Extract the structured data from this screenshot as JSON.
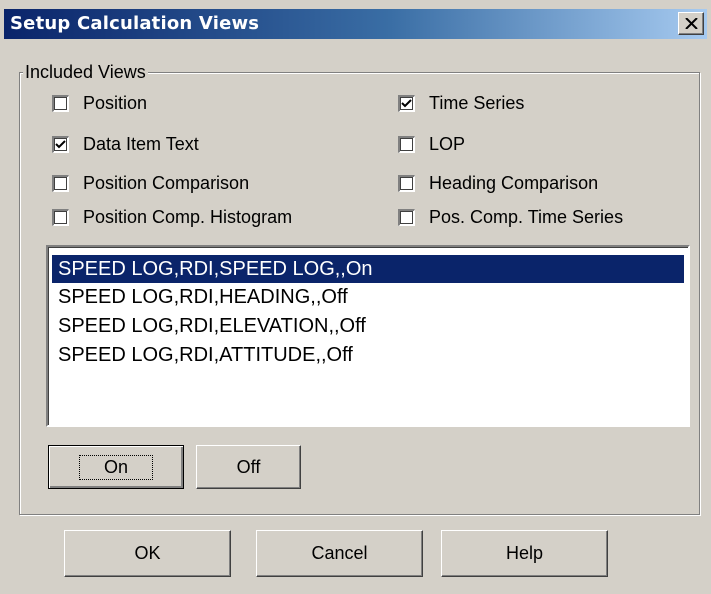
{
  "window": {
    "title": "Setup Calculation Views",
    "close_glyph": "close-icon"
  },
  "included_views": {
    "legend": "Included Views",
    "checkboxes": [
      {
        "label": "Position",
        "checked": false
      },
      {
        "label": "Time Series",
        "checked": true
      },
      {
        "label": "Data Item Text",
        "checked": true
      },
      {
        "label": "LOP",
        "checked": false
      },
      {
        "label": "Position Comparison",
        "checked": false
      },
      {
        "label": "Heading Comparison",
        "checked": false
      },
      {
        "label": "Position Comp. Histogram",
        "checked": false
      },
      {
        "label": "Pos. Comp. Time Series",
        "checked": false
      }
    ],
    "list": [
      {
        "text": "SPEED LOG,RDI,SPEED LOG,,On",
        "selected": true
      },
      {
        "text": "SPEED LOG,RDI,HEADING,,Off",
        "selected": false
      },
      {
        "text": "SPEED LOG,RDI,ELEVATION,,Off",
        "selected": false
      },
      {
        "text": "SPEED LOG,RDI,ATTITUDE,,Off",
        "selected": false
      }
    ],
    "on_label": "On",
    "off_label": "Off"
  },
  "footer": {
    "ok_label": "OK",
    "cancel_label": "Cancel",
    "help_label": "Help"
  },
  "colors": {
    "face": "#d4d0c8",
    "title_start": "#0a246a",
    "title_end": "#a6caf0",
    "selection": "#0a246a"
  }
}
